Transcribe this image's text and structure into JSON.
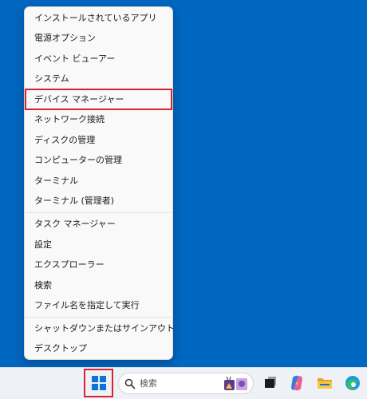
{
  "context_menu": {
    "groups": [
      [
        "インストールされているアプリ",
        "電源オプション",
        "イベント ビューアー",
        "システム",
        "デバイス マネージャー",
        "ネットワーク接続",
        "ディスクの管理",
        "コンピューターの管理",
        "ターミナル",
        "ターミナル (管理者)"
      ],
      [
        "タスク マネージャー",
        "設定",
        "エクスプローラー",
        "検索",
        "ファイル名を指定して実行"
      ],
      [
        "シャットダウンまたはサインアウト",
        "デスクトップ"
      ]
    ],
    "highlighted_item": "デバイス マネージャー",
    "submenu_chevron": "›"
  },
  "taskbar": {
    "start_icon": "windows-logo-icon",
    "search_placeholder": "検索",
    "search_icon": "search-icon",
    "pinned_icons": [
      "task-view-icon",
      "copilot-icon",
      "file-explorer-icon",
      "edge-icon"
    ]
  },
  "colors": {
    "desktop": "#0067c0",
    "menu_background": "#f9f9f9",
    "highlight_border": "#d9222f",
    "taskbar": "#eef1f6"
  }
}
